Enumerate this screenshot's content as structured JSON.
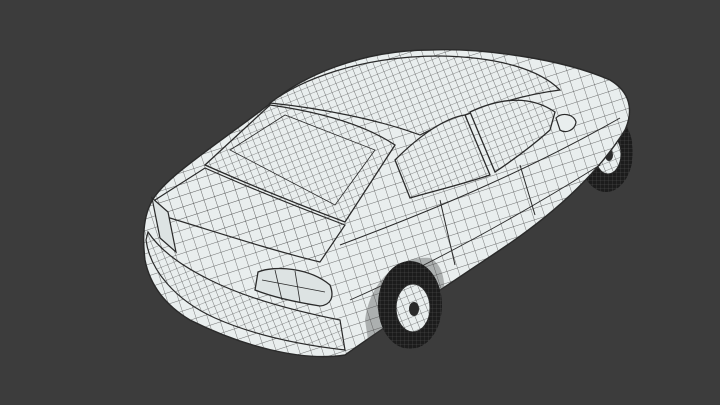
{
  "viewport": {
    "background_color": "#3c3c3c"
  },
  "model": {
    "subject": "sedan-car-wireframe",
    "view": "rear-three-quarter",
    "surface_color": "#e9eeee",
    "wire_color": "#2a2a2a",
    "tire_color": "#1c1c1c"
  }
}
